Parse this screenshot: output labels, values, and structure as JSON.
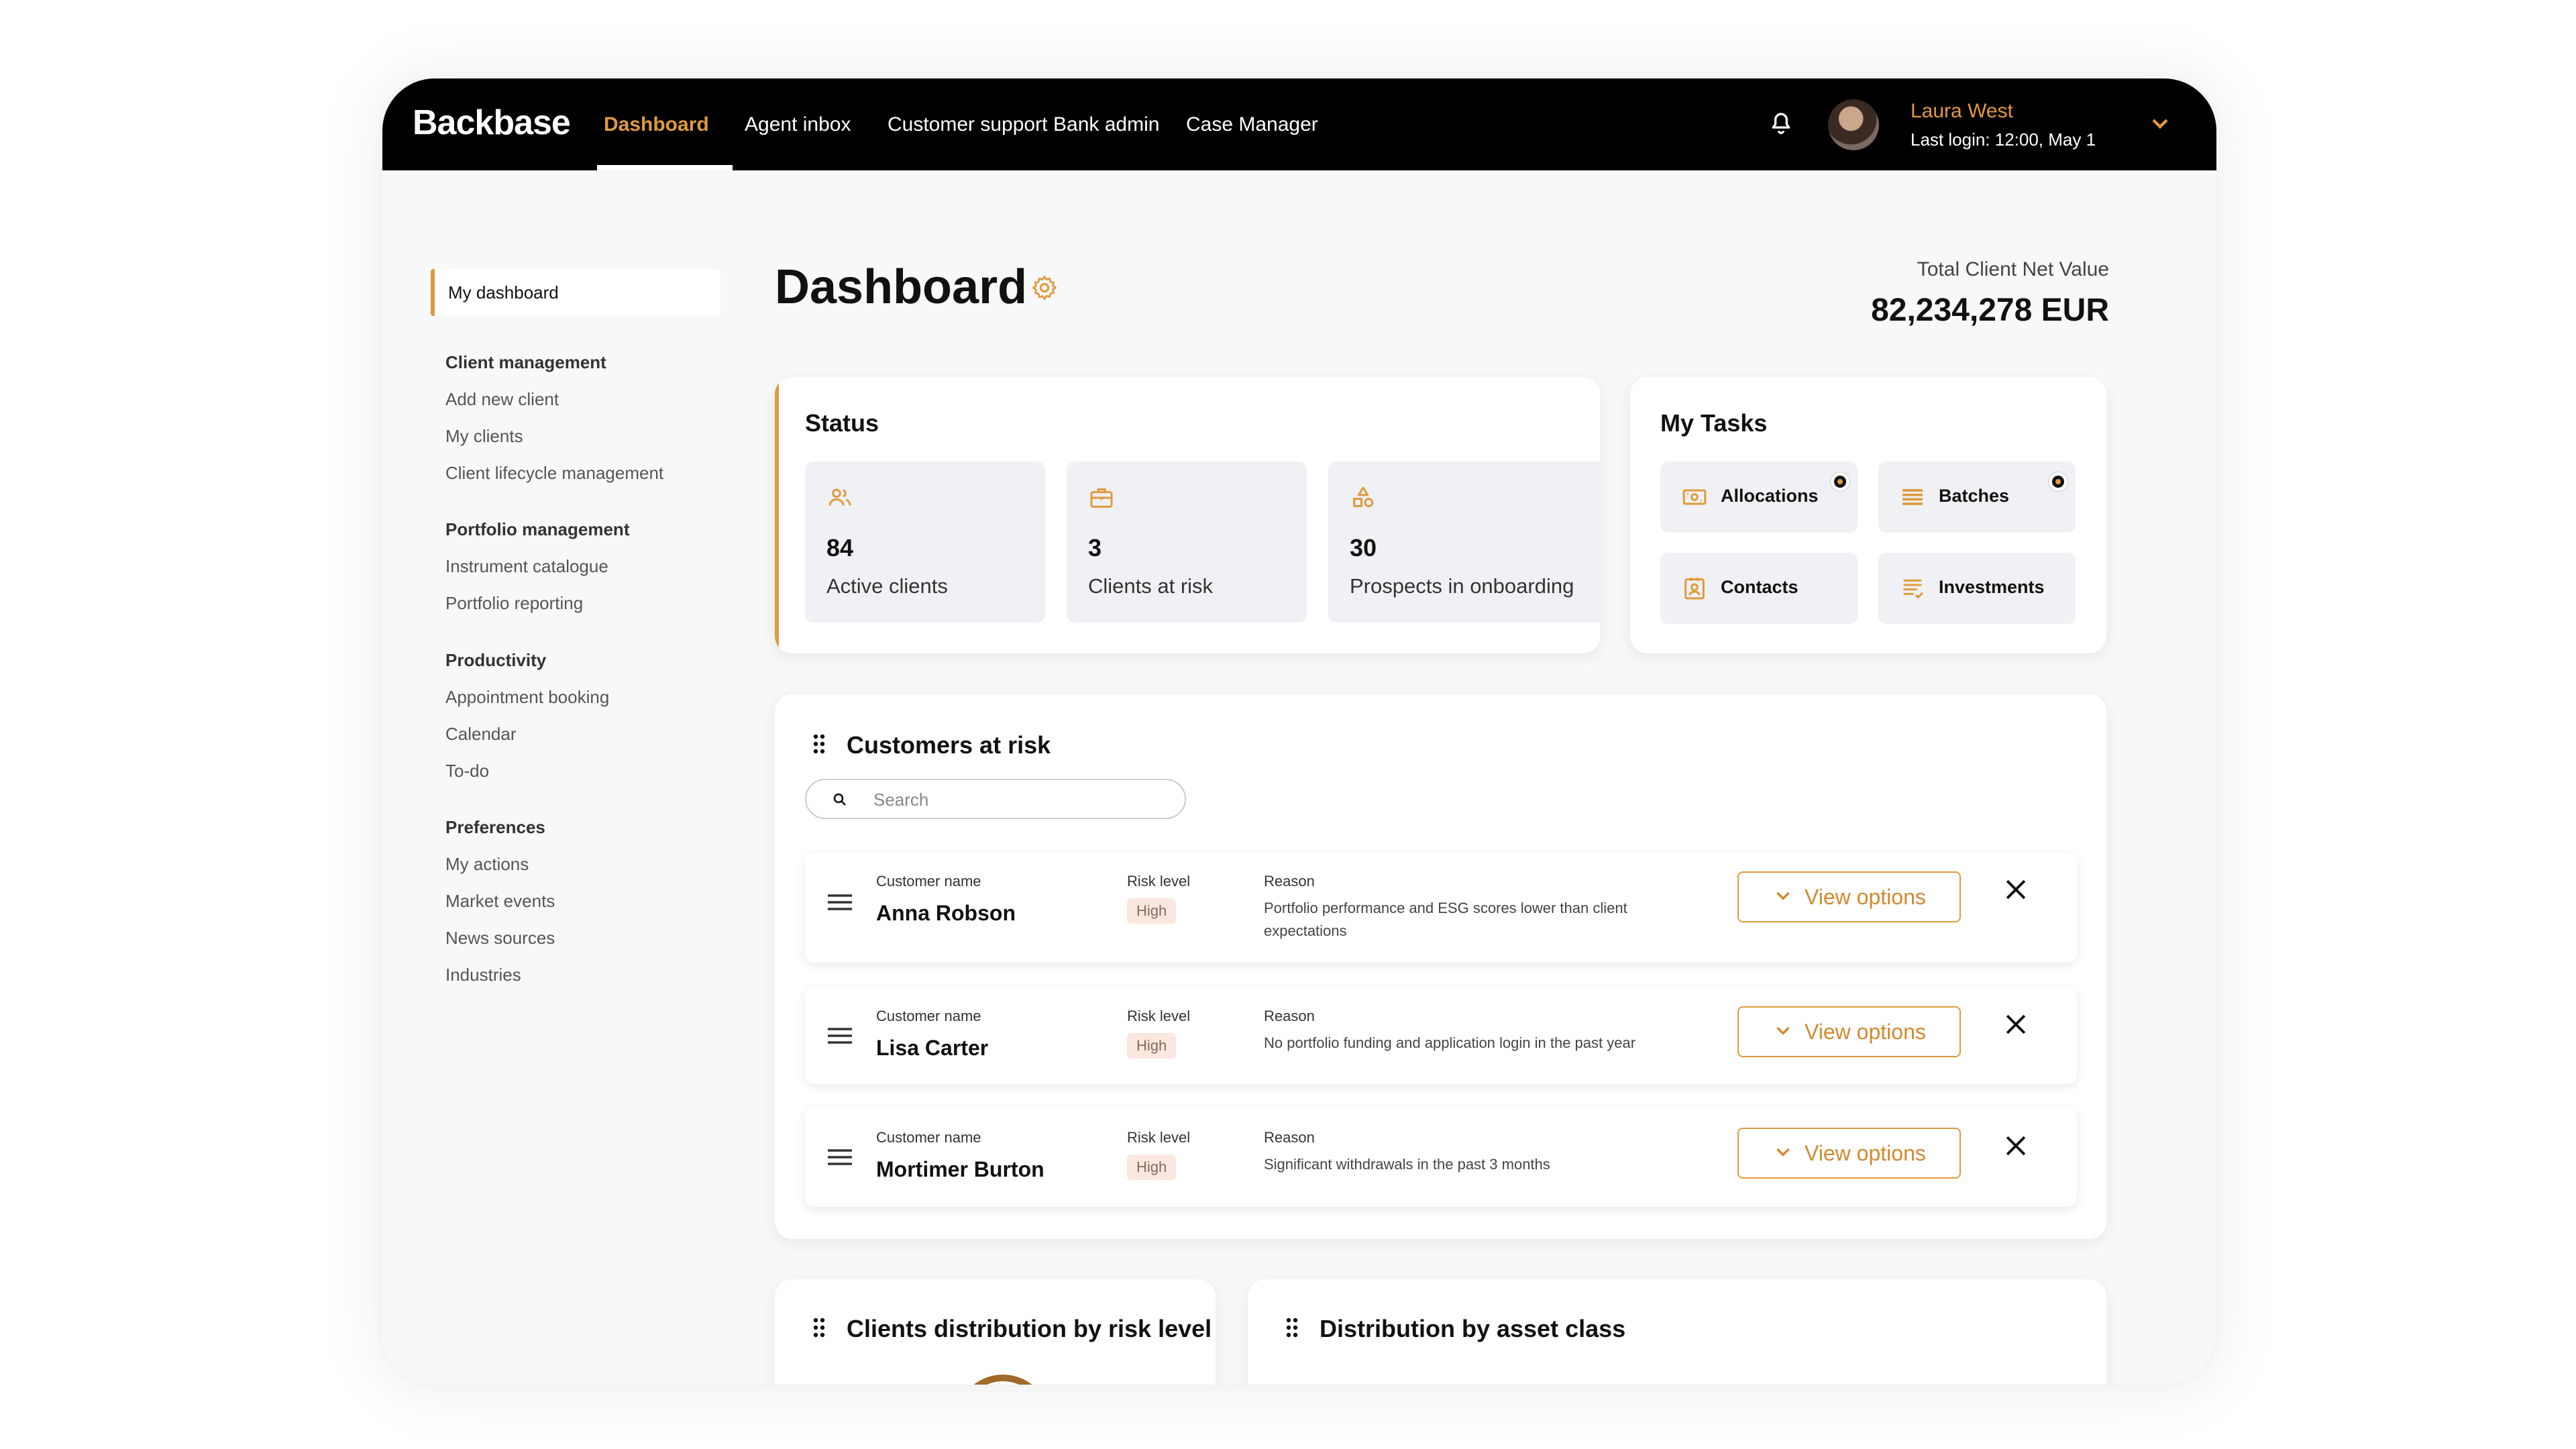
{
  "app": {
    "logo": "Backbase"
  },
  "nav": {
    "items": [
      {
        "label": "Dashboard",
        "active": true
      },
      {
        "label": "Agent inbox"
      },
      {
        "label": "Customer support"
      },
      {
        "label": "Bank admin"
      },
      {
        "label": "Case Manager"
      }
    ]
  },
  "user": {
    "name": "Laura West",
    "last_login": "Last login: 12:00, May 1"
  },
  "sidebar": {
    "active": "My dashboard",
    "groups": [
      {
        "title": "Client management",
        "items": [
          "Add new client",
          "My clients",
          "Client lifecycle management"
        ]
      },
      {
        "title": "Portfolio management",
        "items": [
          "Instrument catalogue",
          "Portfolio reporting"
        ]
      },
      {
        "title": "Productivity",
        "items": [
          "Appointment booking",
          "Calendar",
          "To-do"
        ]
      },
      {
        "title": "Preferences",
        "items": [
          "My actions",
          "Market events",
          "News sources",
          "Industries"
        ]
      }
    ]
  },
  "page": {
    "title": "Dashboard"
  },
  "net_value": {
    "label": "Total Client Net Value",
    "value": "82,234,278 EUR"
  },
  "status": {
    "title": "Status",
    "tiles": [
      {
        "value": "84",
        "label": "Active clients",
        "icon": "users-icon"
      },
      {
        "value": "3",
        "label": "Clients at risk",
        "icon": "briefcase-icon"
      },
      {
        "value": "30",
        "label": "Prospects in onboarding",
        "icon": "shapes-icon"
      }
    ]
  },
  "tasks": {
    "title": "My Tasks",
    "tiles": [
      {
        "label": "Allocations",
        "icon": "cash-icon",
        "notification": true
      },
      {
        "label": "Batches",
        "icon": "list-icon",
        "notification": true
      },
      {
        "label": "Contacts",
        "icon": "contact-card-icon",
        "notification": false
      },
      {
        "label": "Investments",
        "icon": "document-lines-icon",
        "notification": false
      }
    ]
  },
  "risk": {
    "title": "Customers at risk",
    "search_placeholder": "Search",
    "col_name": "Customer name",
    "col_risk": "Risk level",
    "col_reason": "Reason",
    "action_label": "View options",
    "rows": [
      {
        "name": "Anna Robson",
        "risk": "High",
        "reason": "Portfolio performance and ESG scores lower than client expectations"
      },
      {
        "name": "Lisa Carter",
        "risk": "High",
        "reason": "No portfolio funding and application login in the past year"
      },
      {
        "name": "Mortimer Burton",
        "risk": "High",
        "reason": "Significant withdrawals in the past 3 months"
      }
    ]
  },
  "bottom": {
    "card1_title": "Clients distribution by risk level",
    "card2_title": "Distribution by asset class"
  },
  "colors": {
    "accent": "#e09a3c",
    "topbar": "#000000",
    "badge_bg": "#f9e7e0"
  }
}
